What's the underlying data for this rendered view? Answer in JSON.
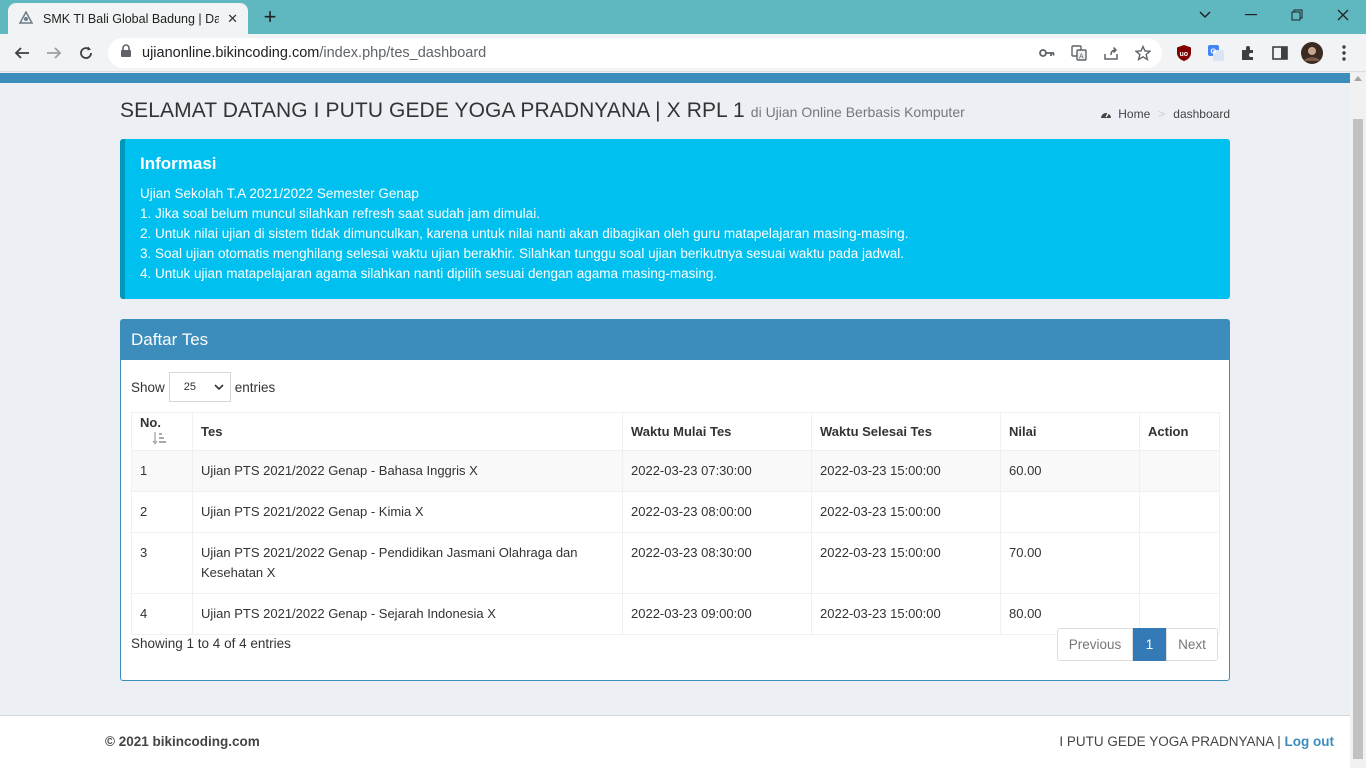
{
  "browser": {
    "tab_title": "SMK TI Bali Global Badung | Dash",
    "url_host": "ujianonline.bikincoding.com",
    "url_path": "/index.php/tes_dashboard"
  },
  "header": {
    "title": "SELAMAT DATANG I PUTU GEDE YOGA PRADNYANA | X RPL 1",
    "subtitle": "di Ujian Online Berbasis Komputer",
    "breadcrumb_home": "Home",
    "breadcrumb_current": "dashboard"
  },
  "info": {
    "title": "Informasi",
    "lines": [
      "Ujian Sekolah T.A 2021/2022 Semester Genap",
      "1. Jika soal belum muncul silahkan refresh saat sudah jam dimulai.",
      "2. Untuk nilai ujian di sistem tidak dimunculkan, karena untuk nilai nanti akan dibagikan oleh guru matapelajaran masing-masing.",
      "3. Soal ujian otomatis menghilang selesai waktu ujian berakhir. Silahkan tunggu soal ujian berikutnya sesuai waktu pada jadwal.",
      "4. Untuk ujian matapelajaran agama silahkan nanti dipilih sesuai dengan agama masing-masing."
    ]
  },
  "box": {
    "title": "Daftar Tes",
    "show_label": "Show",
    "entries_value": "25",
    "entries_label": "entries",
    "columns": [
      "No.",
      "Tes",
      "Waktu Mulai Tes",
      "Waktu Selesai Tes",
      "Nilai",
      "Action"
    ],
    "rows": [
      {
        "no": "1",
        "tes": "Ujian PTS 2021/2022 Genap - Bahasa Inggris X",
        "mulai": "2022-03-23 07:30:00",
        "selesai": "2022-03-23 15:00:00",
        "nilai": "60.00",
        "action": ""
      },
      {
        "no": "2",
        "tes": "Ujian PTS 2021/2022 Genap - Kimia X",
        "mulai": "2022-03-23 08:00:00",
        "selesai": "2022-03-23 15:00:00",
        "nilai": "",
        "action": ""
      },
      {
        "no": "3",
        "tes": "Ujian PTS 2021/2022 Genap - Pendidikan Jasmani Olahraga dan Kesehatan X",
        "mulai": "2022-03-23 08:30:00",
        "selesai": "2022-03-23 15:00:00",
        "nilai": "70.00",
        "action": ""
      },
      {
        "no": "4",
        "tes": "Ujian PTS 2021/2022 Genap - Sejarah Indonesia X",
        "mulai": "2022-03-23 09:00:00",
        "selesai": "2022-03-23 15:00:00",
        "nilai": "80.00",
        "action": ""
      }
    ],
    "info_text": "Showing 1 to 4 of 4 entries",
    "prev_label": "Previous",
    "page_label": "1",
    "next_label": "Next"
  },
  "footer": {
    "copyright": "© 2021 bikincoding.com",
    "user": "I PUTU GEDE YOGA PRADNYANA |",
    "logout": "Log out"
  },
  "colors": {
    "primary": "#3c8dbc",
    "info": "#00c0ef",
    "tabbar": "#5fb8c0"
  }
}
